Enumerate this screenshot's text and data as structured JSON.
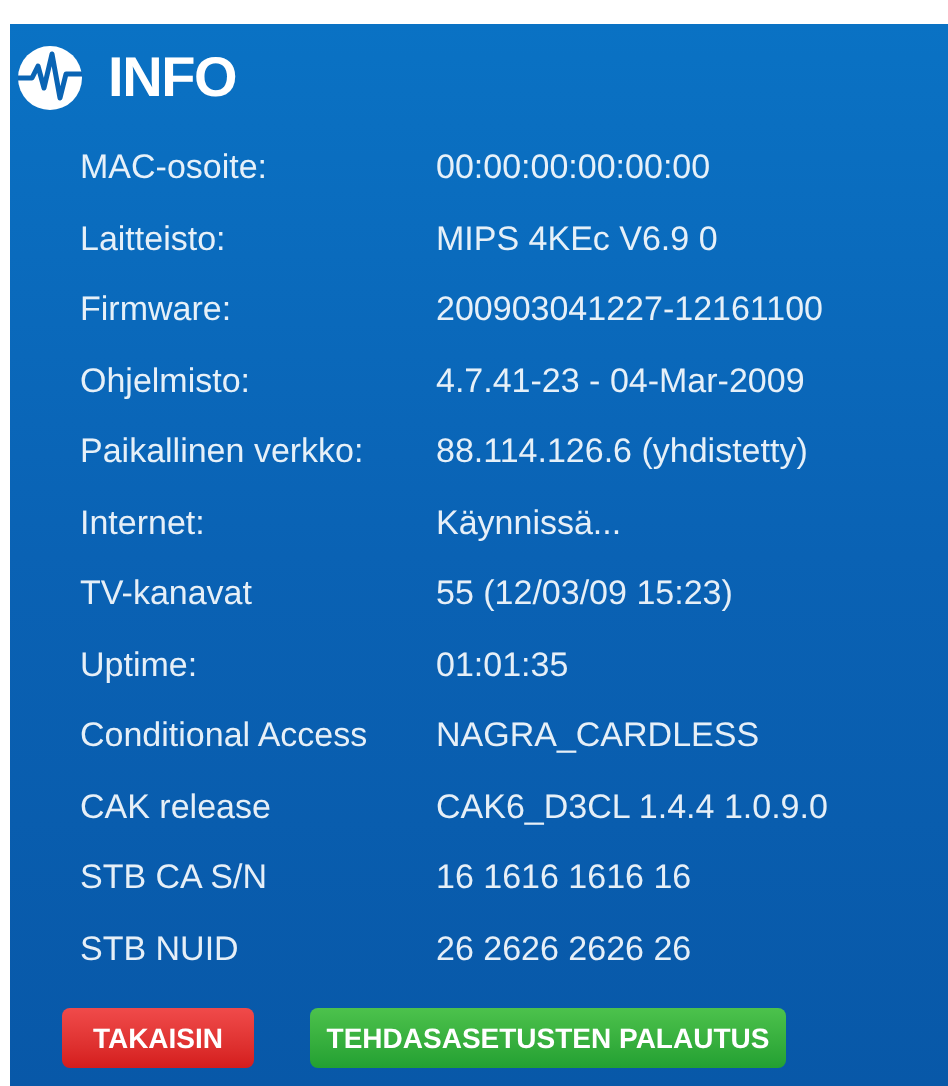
{
  "title": "INFO",
  "rows": [
    {
      "label": "MAC-osoite:",
      "value": "00:00:00:00:00:00"
    },
    {
      "label": "Laitteisto:",
      "value": "MIPS 4KEc V6.9 0"
    },
    {
      "label": "Firmware:",
      "value": "200903041227-12161100"
    },
    {
      "label": "Ohjelmisto:",
      "value": "4.7.41-23 - 04-Mar-2009"
    },
    {
      "label": "Paikallinen verkko:",
      "value": "88.114.126.6 (yhdistetty)"
    },
    {
      "label": "Internet:",
      "value": "Käynnissä..."
    },
    {
      "label": "TV-kanavat",
      "value": "55 (12/03/09 15:23)"
    },
    {
      "label": "Uptime:",
      "value": "01:01:35"
    },
    {
      "label": "Conditional Access",
      "value": "NAGRA_CARDLESS"
    },
    {
      "label": "CAK release",
      "value": "CAK6_D3CL 1.4.4 1.0.9.0"
    },
    {
      "label": "STB CA S/N",
      "value": "16 1616 1616 16"
    },
    {
      "label": "STB NUID",
      "value": "26 2626 2626 26"
    }
  ],
  "buttons": [
    {
      "label": "TAKAISIN",
      "kind": "back"
    },
    {
      "label": "TEHDASASETUSTEN PALAUTUS",
      "kind": "reset"
    }
  ]
}
